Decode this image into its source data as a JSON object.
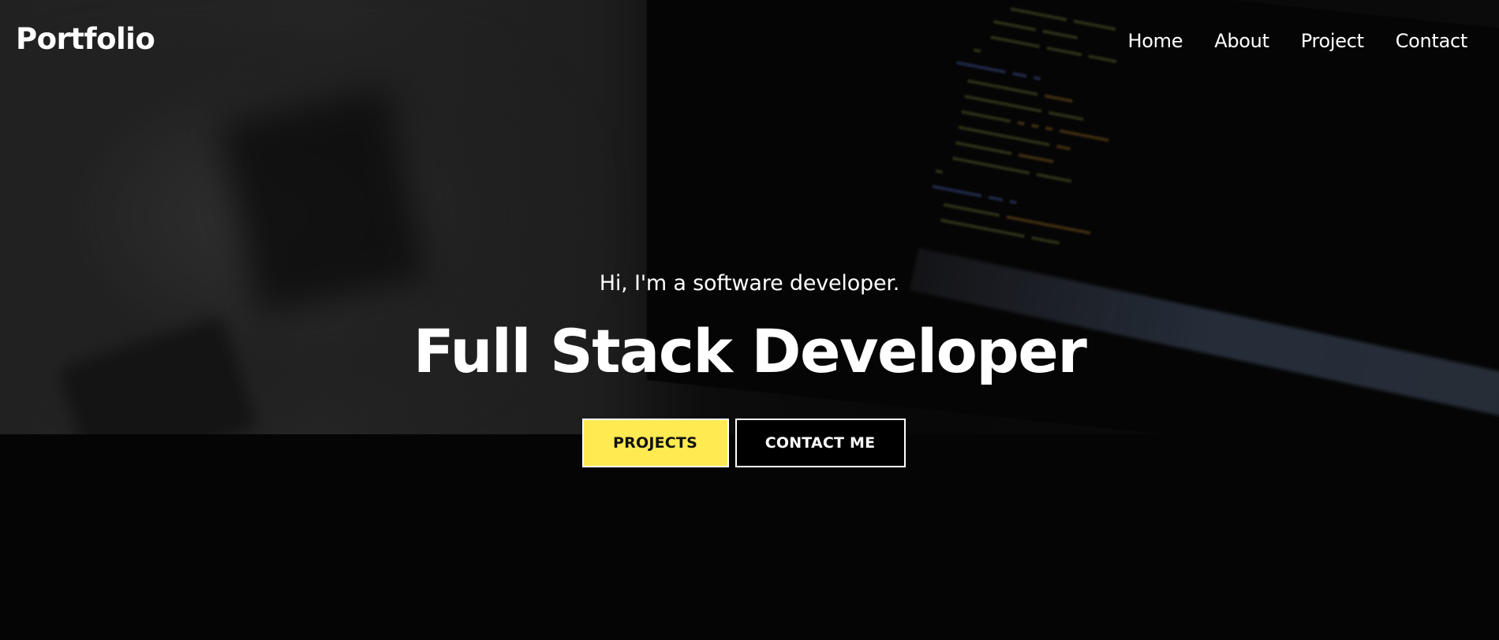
{
  "nav": {
    "brand": "Portfolio",
    "links": [
      "Home",
      "About",
      "Project",
      "Contact"
    ]
  },
  "hero": {
    "subtitle": "Hi, I'm a software developer.",
    "title": "Full Stack Developer",
    "buttons": {
      "primary": "PROJECTS",
      "secondary": "CONTACT ME"
    }
  },
  "colors": {
    "accent": "#ffea52",
    "background": "#050505",
    "text": "#ffffff"
  }
}
